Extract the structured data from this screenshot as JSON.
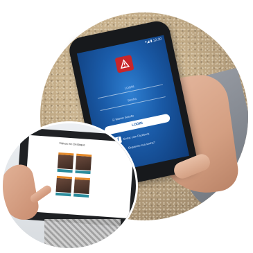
{
  "phone": {
    "status_time": "▾◢ ▮ 12:30",
    "brand_text": "",
    "username_placeholder": "LOGIN",
    "password_placeholder": "Senha",
    "remember_label": "☑ Manter Sessão",
    "login_label": "LOGIN",
    "facebook_label": "Entrar com Facebook",
    "forgot_label": "Esqueceu sua senha?"
  },
  "tablet": {
    "header_text": "Vídeos em Destaque"
  },
  "colors": {
    "phone_screen": "#1a5ba8",
    "logo_red": "#c8262a",
    "tile_accent": "#e58a2a",
    "tile_caption": "#2a8c9c"
  },
  "icons": {
    "app_logo": "warning-triangle-icon",
    "facebook": "facebook-icon"
  }
}
